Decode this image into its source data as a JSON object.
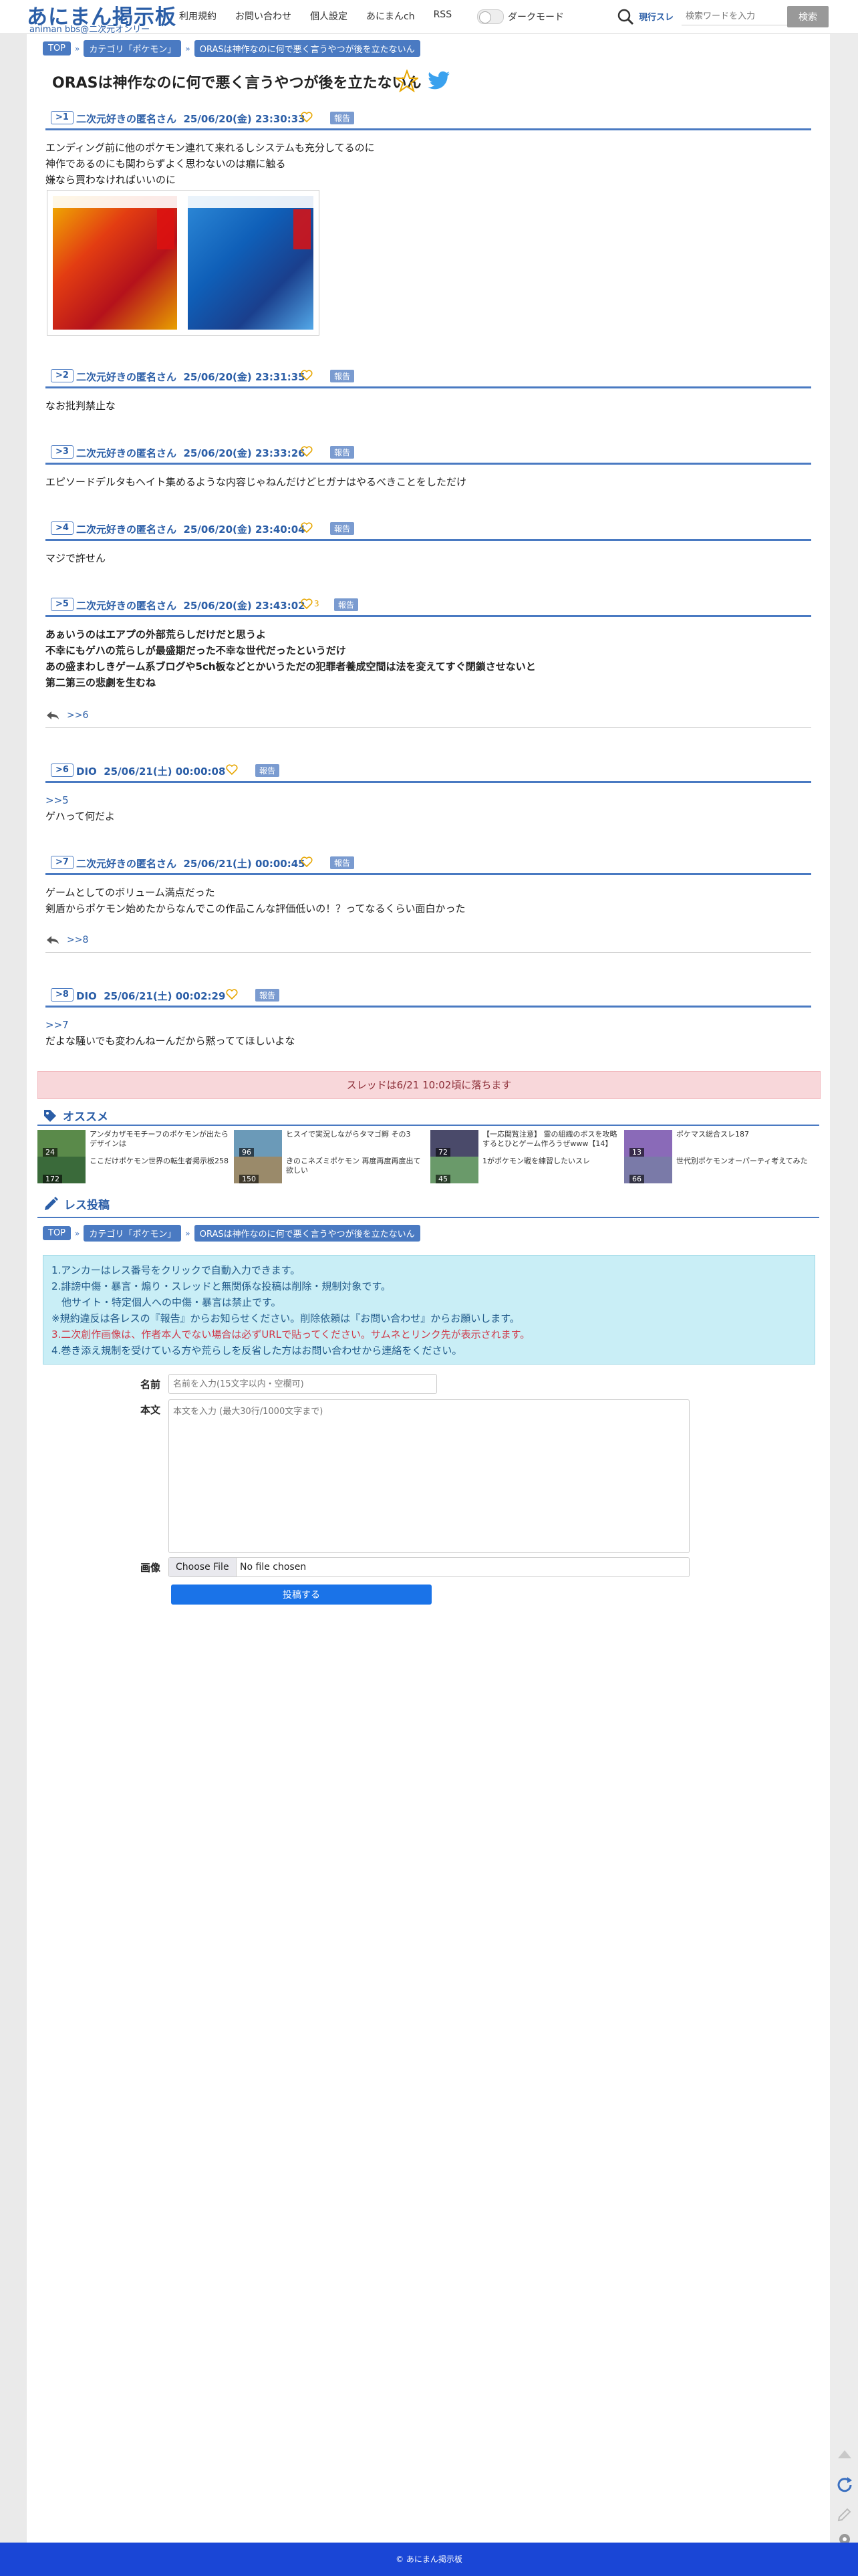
{
  "header": {
    "logo_main": "あにまん掲示板",
    "logo_sub": "animan bbs@二次元オンリー",
    "nav": [
      "利用規約",
      "お問い合わせ",
      "個人設定",
      "あにまんch",
      "RSS"
    ],
    "dark_mode_label": "ダークモード",
    "search_scope": "現行スレ",
    "search_placeholder": "検索ワードを入力",
    "search_button": "検索"
  },
  "breadcrumb": [
    "TOP",
    "カテゴリ「ポケモン」",
    "ORASは神作なのに何で悪く言うやつが後を立たないん"
  ],
  "thread_title": "ORASは神作なのに何で悪く言うやつが後を立たないん",
  "report_label": "報告",
  "posts": [
    {
      "num": "1",
      "name": "二次元好きの匿名さん",
      "date": "25/06/20(金) 23:30:33",
      "lines": [
        "エンディング前に他のポケモン連れて来れるしシステムも充分してるのに",
        "神作であるのにも関わらずよく思わないのは癪に触る",
        "嫌なら買わなければいいのに"
      ],
      "likes": ""
    },
    {
      "num": "2",
      "name": "二次元好きの匿名さん",
      "date": "25/06/20(金) 23:31:35",
      "lines": [
        "なお批判禁止な"
      ],
      "likes": ""
    },
    {
      "num": "3",
      "name": "二次元好きの匿名さん",
      "date": "25/06/20(金) 23:33:26",
      "lines": [
        "エピソードデルタもヘイト集めるような内容じゃねんだけどヒガナはやるべきことをしただけ"
      ],
      "likes": ""
    },
    {
      "num": "4",
      "name": "二次元好きの匿名さん",
      "date": "25/06/20(金) 23:40:04",
      "lines": [
        "マジで許せん"
      ],
      "likes": ""
    },
    {
      "num": "5",
      "name": "二次元好きの匿名さん",
      "date": "25/06/20(金) 23:43:02",
      "lines": [
        "あぁいうのはエアプの外部荒らしだけだと思うよ",
        "不幸にもゲハの荒らしが最盛期だった不幸な世代だったというだけ",
        "あの盛まわしきゲーム系ブログや5ch板などとかいうただの犯罪者養成空間は法を変えてすぐ閉鎖させないと",
        "第二第三の悲劇を生むね"
      ],
      "likes": "3",
      "reply": ">>6"
    },
    {
      "num": "6",
      "name": "DIO",
      "date": "25/06/21(土) 00:00:08",
      "anchor": ">>5",
      "lines": [
        "ゲハって何だよ"
      ],
      "likes": ""
    },
    {
      "num": "7",
      "name": "二次元好きの匿名さん",
      "date": "25/06/21(土) 00:00:45",
      "lines": [
        "ゲームとしてのボリューム満点だった",
        "剣盾からポケモン始めたからなんでこの作品こんな評価低いの！？ってなるくらい面白かった"
      ],
      "likes": "",
      "reply": ">>8"
    },
    {
      "num": "8",
      "name": "DIO",
      "date": "25/06/21(土) 00:02:29",
      "anchor": ">>7",
      "lines": [
        "だよな騒いでも変わんねーんだから黙っててほしいよな"
      ],
      "likes": ""
    }
  ],
  "deadline_notice": "スレッドは6/21 10:02頃に落ちます",
  "recommend": {
    "heading": "オススメ",
    "items": [
      {
        "text": "アンダカザモモチーフのポケモンが出たらデザインは",
        "count": "24",
        "color": "#5a8a4a"
      },
      {
        "text": "ヒスイで実況しながらタマゴ孵 その3",
        "count": "96",
        "color": "#6b9ab8"
      },
      {
        "text": "【一応閲覧注意】 霊の組織のボスを攻略するとひとゲーム作ろうぜwww【14】",
        "count": "72",
        "color": "#4a4a6a"
      },
      {
        "text": "ポケマス総合スレ187",
        "count": "13",
        "color": "#8a6ab8"
      },
      {
        "text": "ここだけポケモン世界の転生者掲示板258",
        "count": "172",
        "color": "#3a6a3a"
      },
      {
        "text": "きのこネズミポケモン 再度再度再度出て欲しい",
        "count": "150",
        "color": "#9a8a6a"
      },
      {
        "text": "1がポケモン戦を練習したいスレ",
        "count": "45",
        "color": "#6a9a6a"
      },
      {
        "text": "世代別ポケモンオーパーティ考えてみた",
        "count": "66",
        "color": "#7a7aa8"
      }
    ]
  },
  "post_form": {
    "heading": "レス投稿",
    "rules": [
      "1.アンカーはレス番号をクリックで自動入力できます。",
      "2.誹謗中傷・暴言・煽り・スレッドと無関係な投稿は削除・規制対象です。",
      "　他サイト・特定個人への中傷・暴言は禁止です。",
      "※規約違反は各レスの『報告』からお知らせください。削除依頼は『お問い合わせ』からお願いします。",
      "3.二次創作画像は、作者本人でない場合は必ずURLで貼ってください。サムネとリンク先が表示されます。",
      "4.巻き添え規制を受けている方や荒らしを反省した方はお問い合わせから連絡をください。"
    ],
    "name_label": "名前",
    "name_placeholder": "名前を入力(15文字以内・空欄可)",
    "body_label": "本文",
    "body_placeholder": "本文を入力 (最大30行/1000文字まで)",
    "image_label": "画像",
    "file_button": "Choose File",
    "file_status": "No file chosen",
    "submit": "投稿する"
  },
  "footer": "© あにまん掲示板",
  "colors": {
    "accent": "#2b5ea7",
    "deadline_bg": "#f8d7da",
    "rules_bg": "#c9eef6",
    "footer": "#1a46d6",
    "submit": "#1a73e8"
  }
}
